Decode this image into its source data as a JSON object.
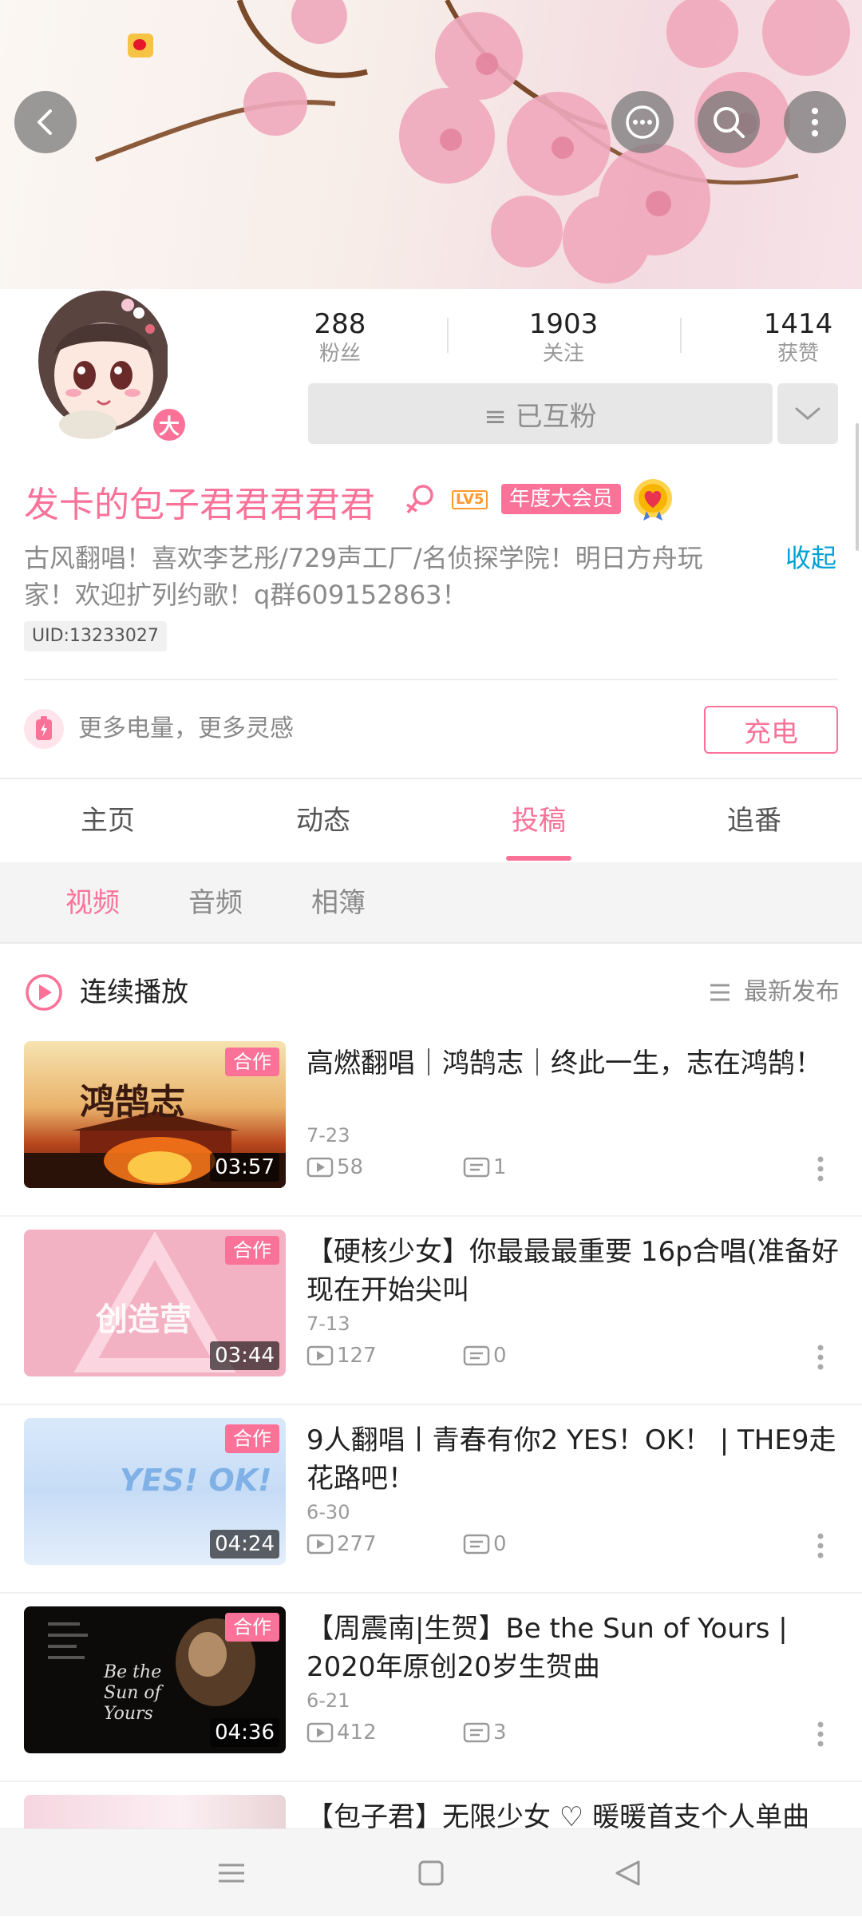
{
  "profile": {
    "username": "发卡的包子君君君君君",
    "level": "LV5",
    "vip_label": "年度大会员",
    "vip_badge": "大",
    "bio": "古风翻唱！喜欢李艺彤/729声工厂/名侦探学院！明日方舟玩家！欢迎扩列约歌！q群609152863！",
    "collapse_label": "收起",
    "uid": "UID:13233027"
  },
  "stats": [
    {
      "value": "288",
      "label": "粉丝"
    },
    {
      "value": "1903",
      "label": "关注"
    },
    {
      "value": "1414",
      "label": "获赞"
    }
  ],
  "follow": {
    "mutual_label": "≡ 已互粉"
  },
  "charge": {
    "text": "更多电量，更多灵感",
    "button": "充电"
  },
  "tabs": [
    {
      "label": "主页"
    },
    {
      "label": "动态"
    },
    {
      "label": "投稿",
      "active": true
    },
    {
      "label": "追番"
    }
  ],
  "subtabs": [
    {
      "label": "视频",
      "active": true
    },
    {
      "label": "音频"
    },
    {
      "label": "相簿"
    }
  ],
  "list_header": {
    "play_all": "连续播放",
    "sort": "最新发布"
  },
  "videos": [
    {
      "badge": "合作",
      "duration": "03:57",
      "title": "高燃翻唱｜鸿鹄志｜终此一生，志在鸿鹄！",
      "date": "7-23",
      "plays": "58",
      "comments": "1",
      "thumb_text": "鸿鹄志"
    },
    {
      "badge": "合作",
      "duration": "03:44",
      "title": "【硬核少女】你最最最重要 16p合唱(准备好现在开始尖叫",
      "date": "7-13",
      "plays": "127",
      "comments": "0",
      "thumb_text": "创造营"
    },
    {
      "badge": "合作",
      "duration": "04:24",
      "title": "9人翻唱丨青春有你2  YES！OK！ | THE9走花路吧！",
      "date": "6-30",
      "plays": "277",
      "comments": "0",
      "thumb_text": "YES! OK!"
    },
    {
      "badge": "合作",
      "duration": "04:36",
      "title": "【周震南|生贺】Be the Sun of Yours | 2020年原创20岁生贺曲",
      "date": "6-21",
      "plays": "412",
      "comments": "3",
      "thumb_text": "Be the Sun of Yours"
    },
    {
      "title": "【包子君】无限少女 ♡ 暖暖首支个人单曲"
    }
  ],
  "colors": {
    "accent": "#fb7299",
    "link": "#00a1d6"
  }
}
